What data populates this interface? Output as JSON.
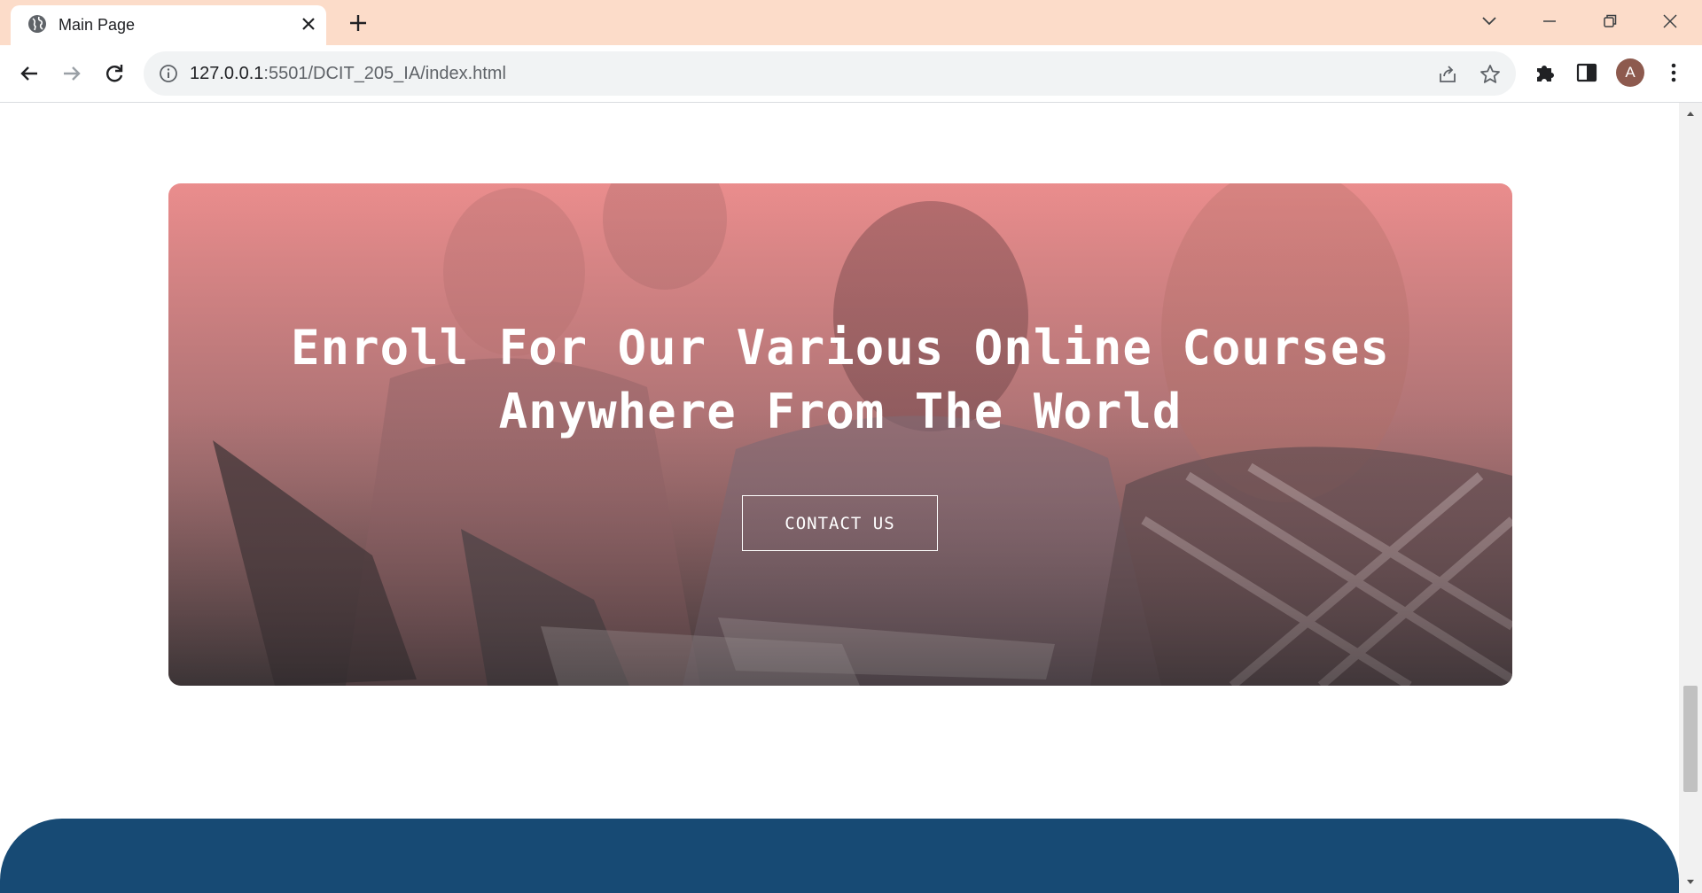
{
  "browser": {
    "tab": {
      "title": "Main Page",
      "favicon": "globe-icon"
    },
    "address_bar": {
      "host": "127.0.0.1",
      "path": ":5501/DCIT_205_IA/index.html"
    },
    "profile_initial": "A",
    "colors": {
      "titlebar": "#fcdcc9",
      "avatar": "#8d5a4e"
    }
  },
  "hero": {
    "heading_line1": "Enroll For Our Various Online Courses",
    "heading_line2": "Anywhere From The World",
    "button_label": "CONTACT US",
    "colors": {
      "overlay_top": "#e88080",
      "overlay_bottom": "#3c3234"
    }
  },
  "footer": {
    "color": "#174a74"
  }
}
